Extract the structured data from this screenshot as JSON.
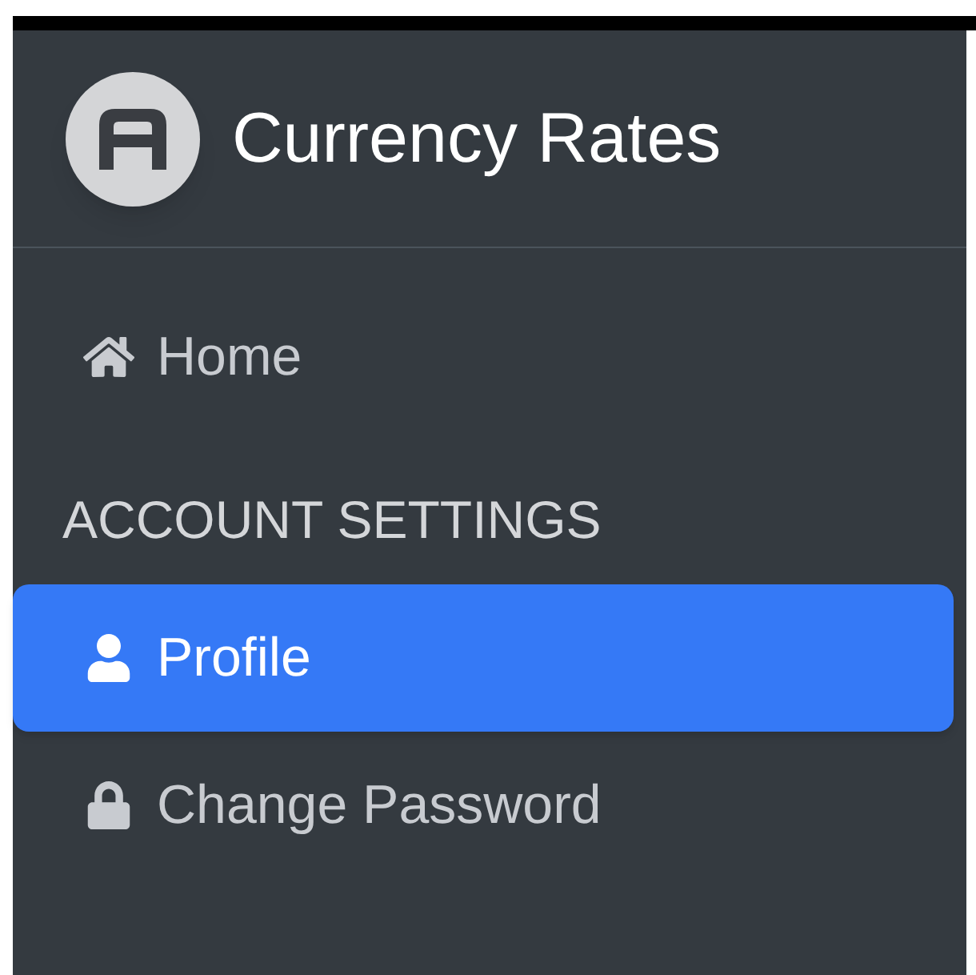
{
  "brand": {
    "title": "Currency Rates"
  },
  "nav": [
    {
      "kind": "link",
      "label": "Home",
      "selected": false
    },
    {
      "kind": "heading",
      "label": "ACCOUNT SETTINGS"
    },
    {
      "kind": "link",
      "label": "Profile",
      "selected": true
    },
    {
      "kind": "link",
      "label": "Change Password",
      "selected": false
    }
  ]
}
